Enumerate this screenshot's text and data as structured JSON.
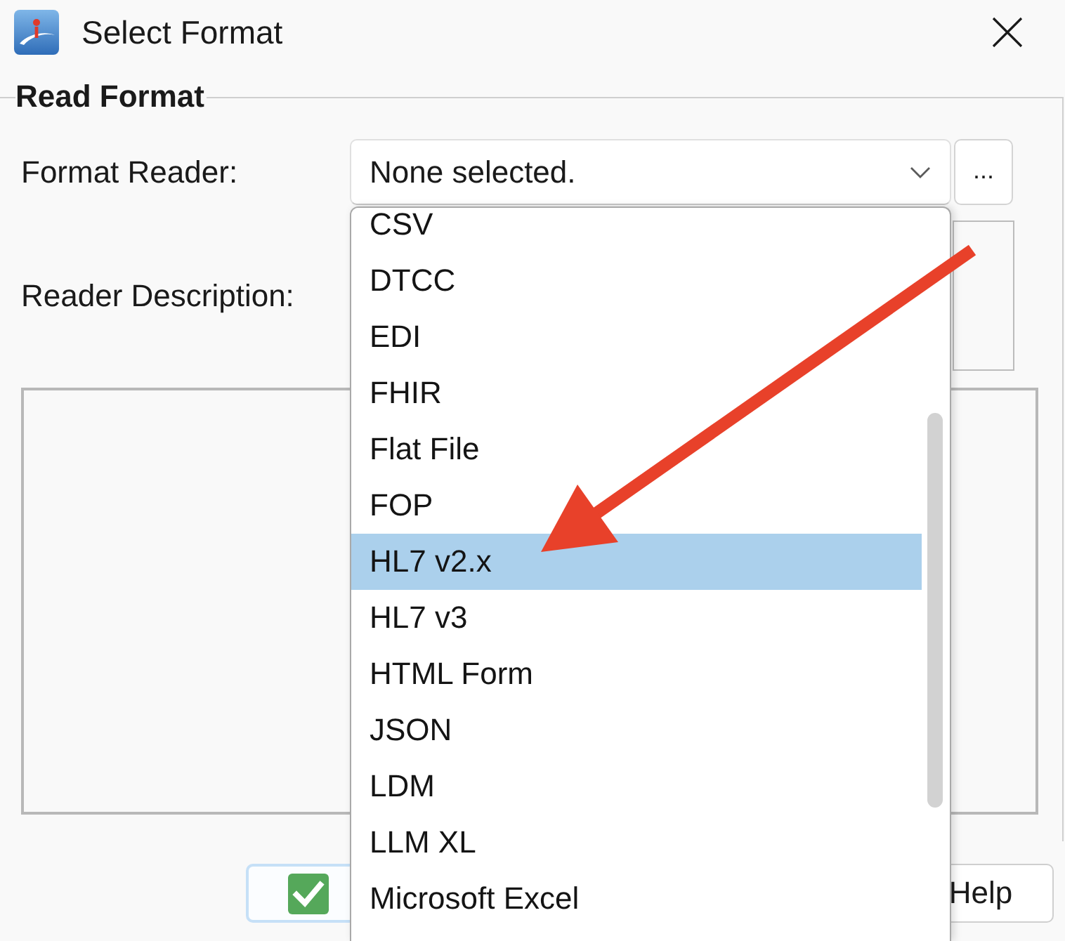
{
  "window": {
    "title": "Select Format"
  },
  "group": {
    "title": "Read Format"
  },
  "format_reader": {
    "label": "Format Reader:",
    "value": "None selected.",
    "expanded": true,
    "browse_button": "...",
    "options": [
      {
        "label": "CSV",
        "selected": false
      },
      {
        "label": "DTCC",
        "selected": false
      },
      {
        "label": "EDI",
        "selected": false
      },
      {
        "label": "FHIR",
        "selected": false
      },
      {
        "label": "Flat File",
        "selected": false
      },
      {
        "label": "FOP",
        "selected": false
      },
      {
        "label": "HL7 v2.x",
        "selected": true
      },
      {
        "label": "HL7 v3",
        "selected": false
      },
      {
        "label": "HTML Form",
        "selected": false
      },
      {
        "label": "JSON",
        "selected": false
      },
      {
        "label": "LDM",
        "selected": false
      },
      {
        "label": "LLM XL",
        "selected": false
      },
      {
        "label": "Microsoft Excel",
        "selected": false
      }
    ]
  },
  "reader_description": {
    "label": "Reader Description:"
  },
  "buttons": [
    {
      "kind": "confirm",
      "focused": true
    },
    {
      "kind": "text",
      "label": "Help",
      "focused": false
    }
  ]
}
